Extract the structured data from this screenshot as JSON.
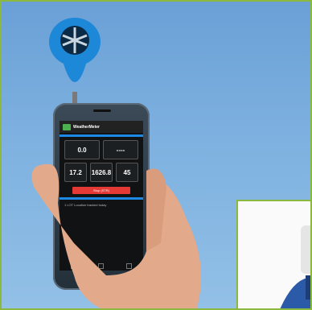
{
  "phone_screen": {
    "app_title": "WeatherMeter",
    "tiles_row1": [
      {
        "value": "0.0",
        "label": ""
      },
      {
        "value": "----",
        "label": ""
      }
    ],
    "tiles_row2": [
      {
        "value": "17.2",
        "label": ""
      },
      {
        "value": "1626.8",
        "label": ""
      },
      {
        "value": "45",
        "label": ""
      }
    ],
    "stop_label": "Stop (STR)",
    "status_text": "1 LOT Location tracked today"
  }
}
